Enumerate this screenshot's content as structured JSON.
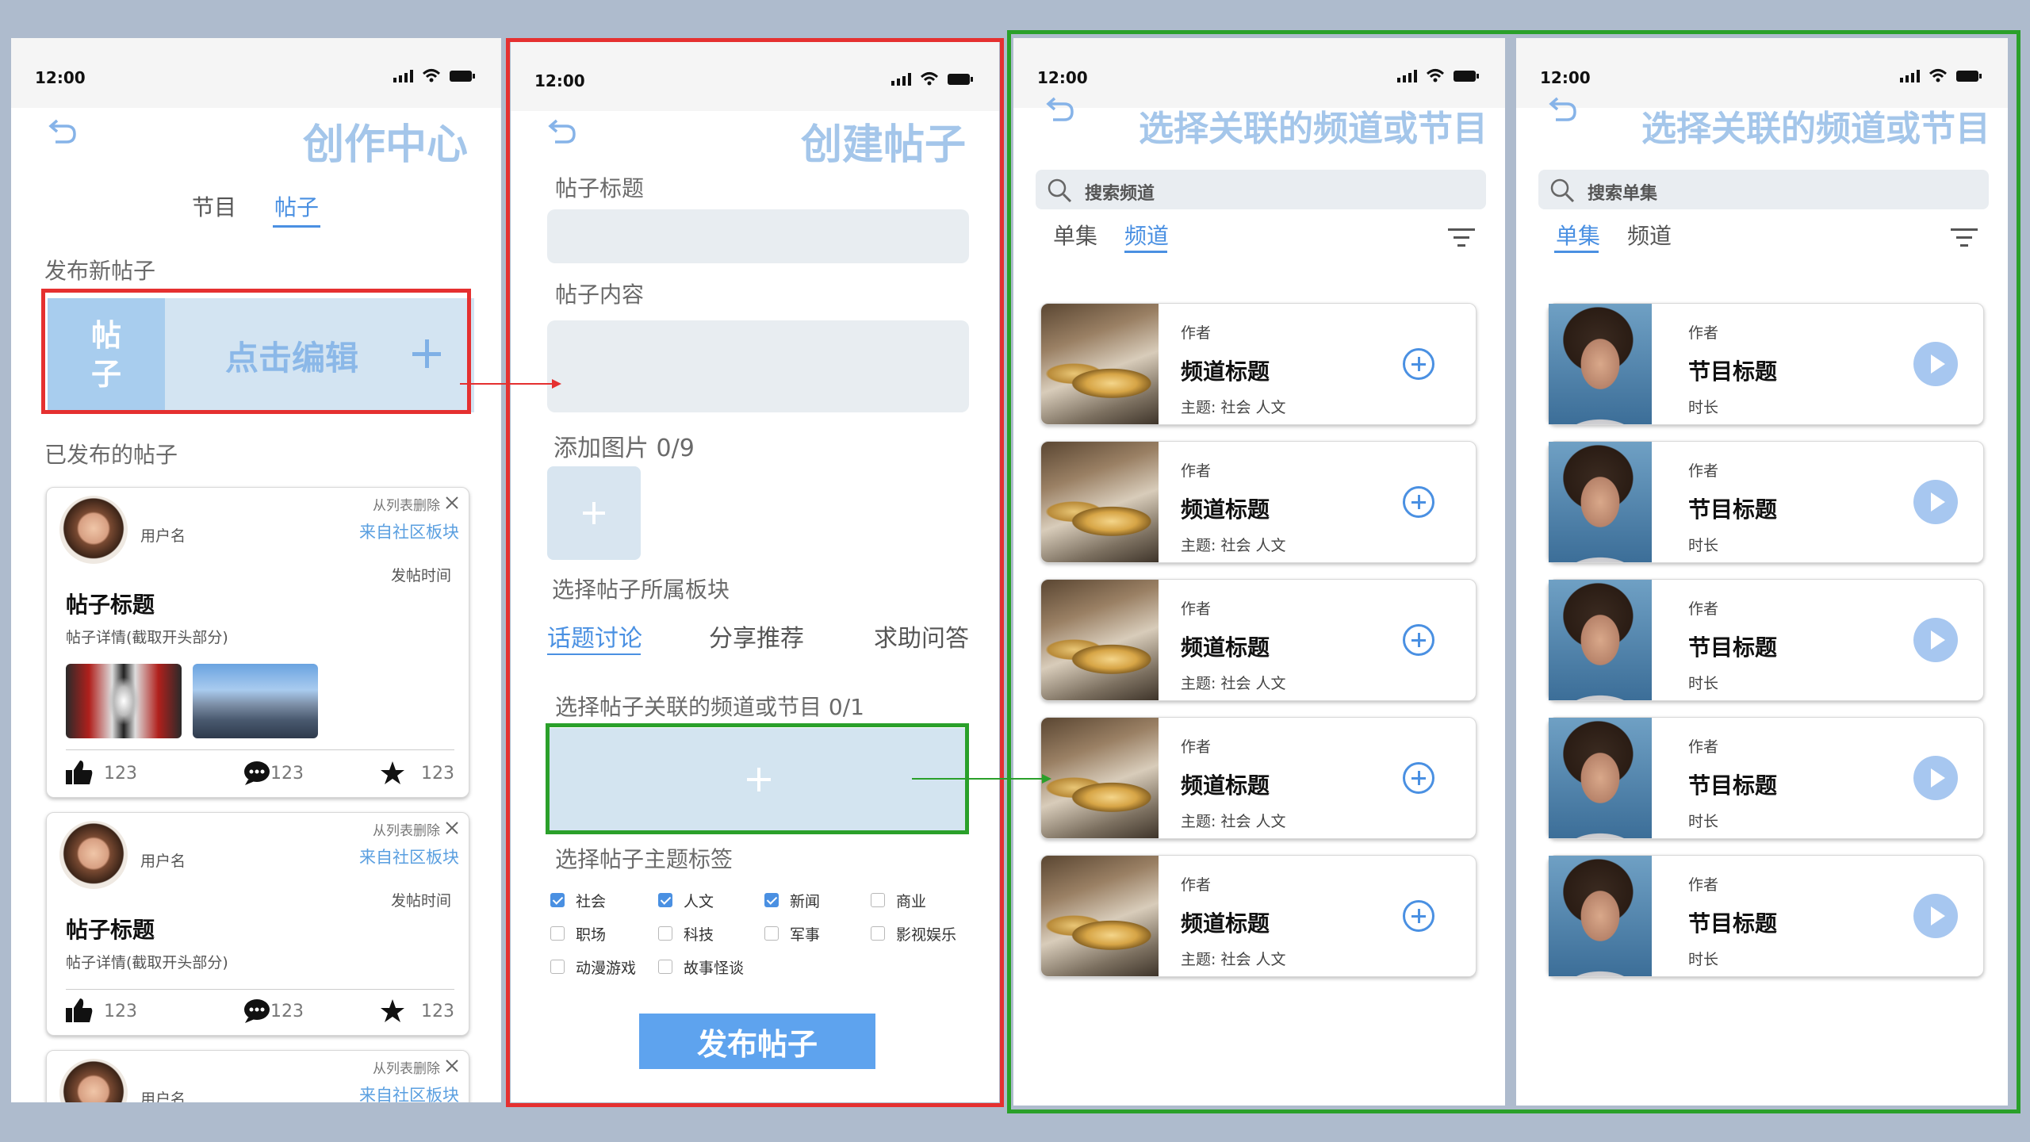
{
  "status_time": "12:00",
  "colors": {
    "frame_red": "#e53030",
    "frame_green": "#2aa02a",
    "accent": "#4a90e2",
    "title": "#a4c6ea"
  },
  "screen1": {
    "title": "创作中心",
    "tabs": [
      "节目",
      "帖子"
    ],
    "active_tab": "帖子",
    "new_post_label": "发布新帖子",
    "new_post_badge": "帖\n子",
    "new_post_edit": "点击编辑",
    "published_label": "已发布的帖子",
    "posts": [
      {
        "remove": "从列表删除",
        "user": "用户名",
        "source": "来自社区板块",
        "time": "发帖时间",
        "title": "帖子标题",
        "detail": "帖子详情(截取开头部分)",
        "likes": "123",
        "comments": "123",
        "stars": "123",
        "has_images": true
      },
      {
        "remove": "从列表删除",
        "user": "用户名",
        "source": "来自社区板块",
        "time": "发帖时间",
        "title": "帖子标题",
        "detail": "帖子详情(截取开头部分)",
        "likes": "123",
        "comments": "123",
        "stars": "123",
        "has_images": false
      },
      {
        "remove": "从列表删除",
        "user": "用户名",
        "source": "来自社区板块"
      }
    ]
  },
  "screen2": {
    "title": "创建帖子",
    "post_title_label": "帖子标题",
    "post_content_label": "帖子内容",
    "add_image_label": "添加图片 0/9",
    "section_label": "选择帖子所属板块",
    "sections": [
      "话题讨论",
      "分享推荐",
      "求助问答"
    ],
    "active_section": "话题讨论",
    "channel_label": "选择帖子关联的频道或节目 0/1",
    "tags_label": "选择帖子主题标签",
    "tags": [
      {
        "label": "社会",
        "checked": true
      },
      {
        "label": "人文",
        "checked": true
      },
      {
        "label": "新闻",
        "checked": true
      },
      {
        "label": "商业",
        "checked": false
      },
      {
        "label": "职场",
        "checked": false
      },
      {
        "label": "科技",
        "checked": false
      },
      {
        "label": "军事",
        "checked": false
      },
      {
        "label": "影视娱乐",
        "checked": false
      },
      {
        "label": "动漫游戏",
        "checked": false
      },
      {
        "label": "故事怪谈",
        "checked": false
      }
    ],
    "publish_button": "发布帖子"
  },
  "screen3": {
    "title": "选择关联的频道或节目",
    "search_placeholder": "搜索频道",
    "tabs": [
      "单集",
      "频道"
    ],
    "active_tab": "频道",
    "items": [
      {
        "author": "作者",
        "title": "频道标题",
        "theme": "主题: 社会 人文"
      },
      {
        "author": "作者",
        "title": "频道标题",
        "theme": "主题: 社会 人文"
      },
      {
        "author": "作者",
        "title": "频道标题",
        "theme": "主题: 社会 人文"
      },
      {
        "author": "作者",
        "title": "频道标题",
        "theme": "主题: 社会 人文"
      },
      {
        "author": "作者",
        "title": "频道标题",
        "theme": "主题: 社会 人文"
      }
    ]
  },
  "screen4": {
    "title": "选择关联的频道或节目",
    "search_placeholder": "搜索单集",
    "tabs": [
      "单集",
      "频道"
    ],
    "active_tab": "单集",
    "items": [
      {
        "author": "作者",
        "title": "节目标题",
        "duration": "时长"
      },
      {
        "author": "作者",
        "title": "节目标题",
        "duration": "时长"
      },
      {
        "author": "作者",
        "title": "节目标题",
        "duration": "时长"
      },
      {
        "author": "作者",
        "title": "节目标题",
        "duration": "时长"
      },
      {
        "author": "作者",
        "title": "节目标题",
        "duration": "时长"
      }
    ]
  }
}
